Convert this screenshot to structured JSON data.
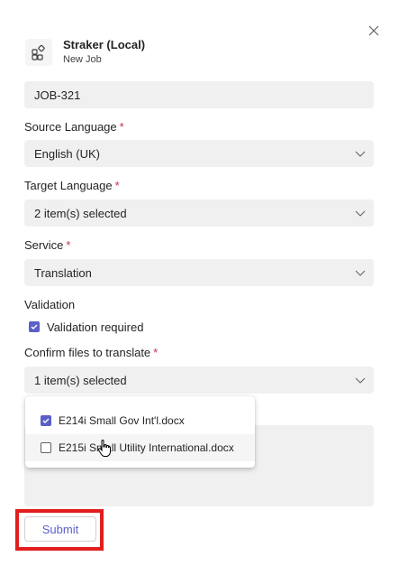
{
  "header": {
    "app_name": "Straker (Local)",
    "subtitle": "New Job",
    "app_icon": "apps-icon",
    "close_icon": "close-icon"
  },
  "job_name": {
    "value": "JOB-321"
  },
  "source_language": {
    "label": "Source Language",
    "required_mark": "*",
    "value": "English (UK)"
  },
  "target_language": {
    "label": "Target Language",
    "required_mark": "*",
    "value": "2 item(s) selected"
  },
  "service": {
    "label": "Service",
    "required_mark": "*",
    "value": "Translation"
  },
  "validation": {
    "label": "Validation",
    "checkbox_label": "Validation required",
    "checked": true
  },
  "confirm_files": {
    "label": "Confirm files to translate",
    "required_mark": "*",
    "value": "1 item(s) selected",
    "options": [
      {
        "label": "E214i Small Gov Int'l.docx",
        "checked": true
      },
      {
        "label": "E215i Small Utility International.docx",
        "checked": false
      }
    ]
  },
  "submit": {
    "label": "Submit"
  },
  "colors": {
    "accent": "#5b5fc7",
    "required": "#c4314b",
    "highlight": "#e11d1d",
    "field_bg": "#f0f0f0"
  }
}
